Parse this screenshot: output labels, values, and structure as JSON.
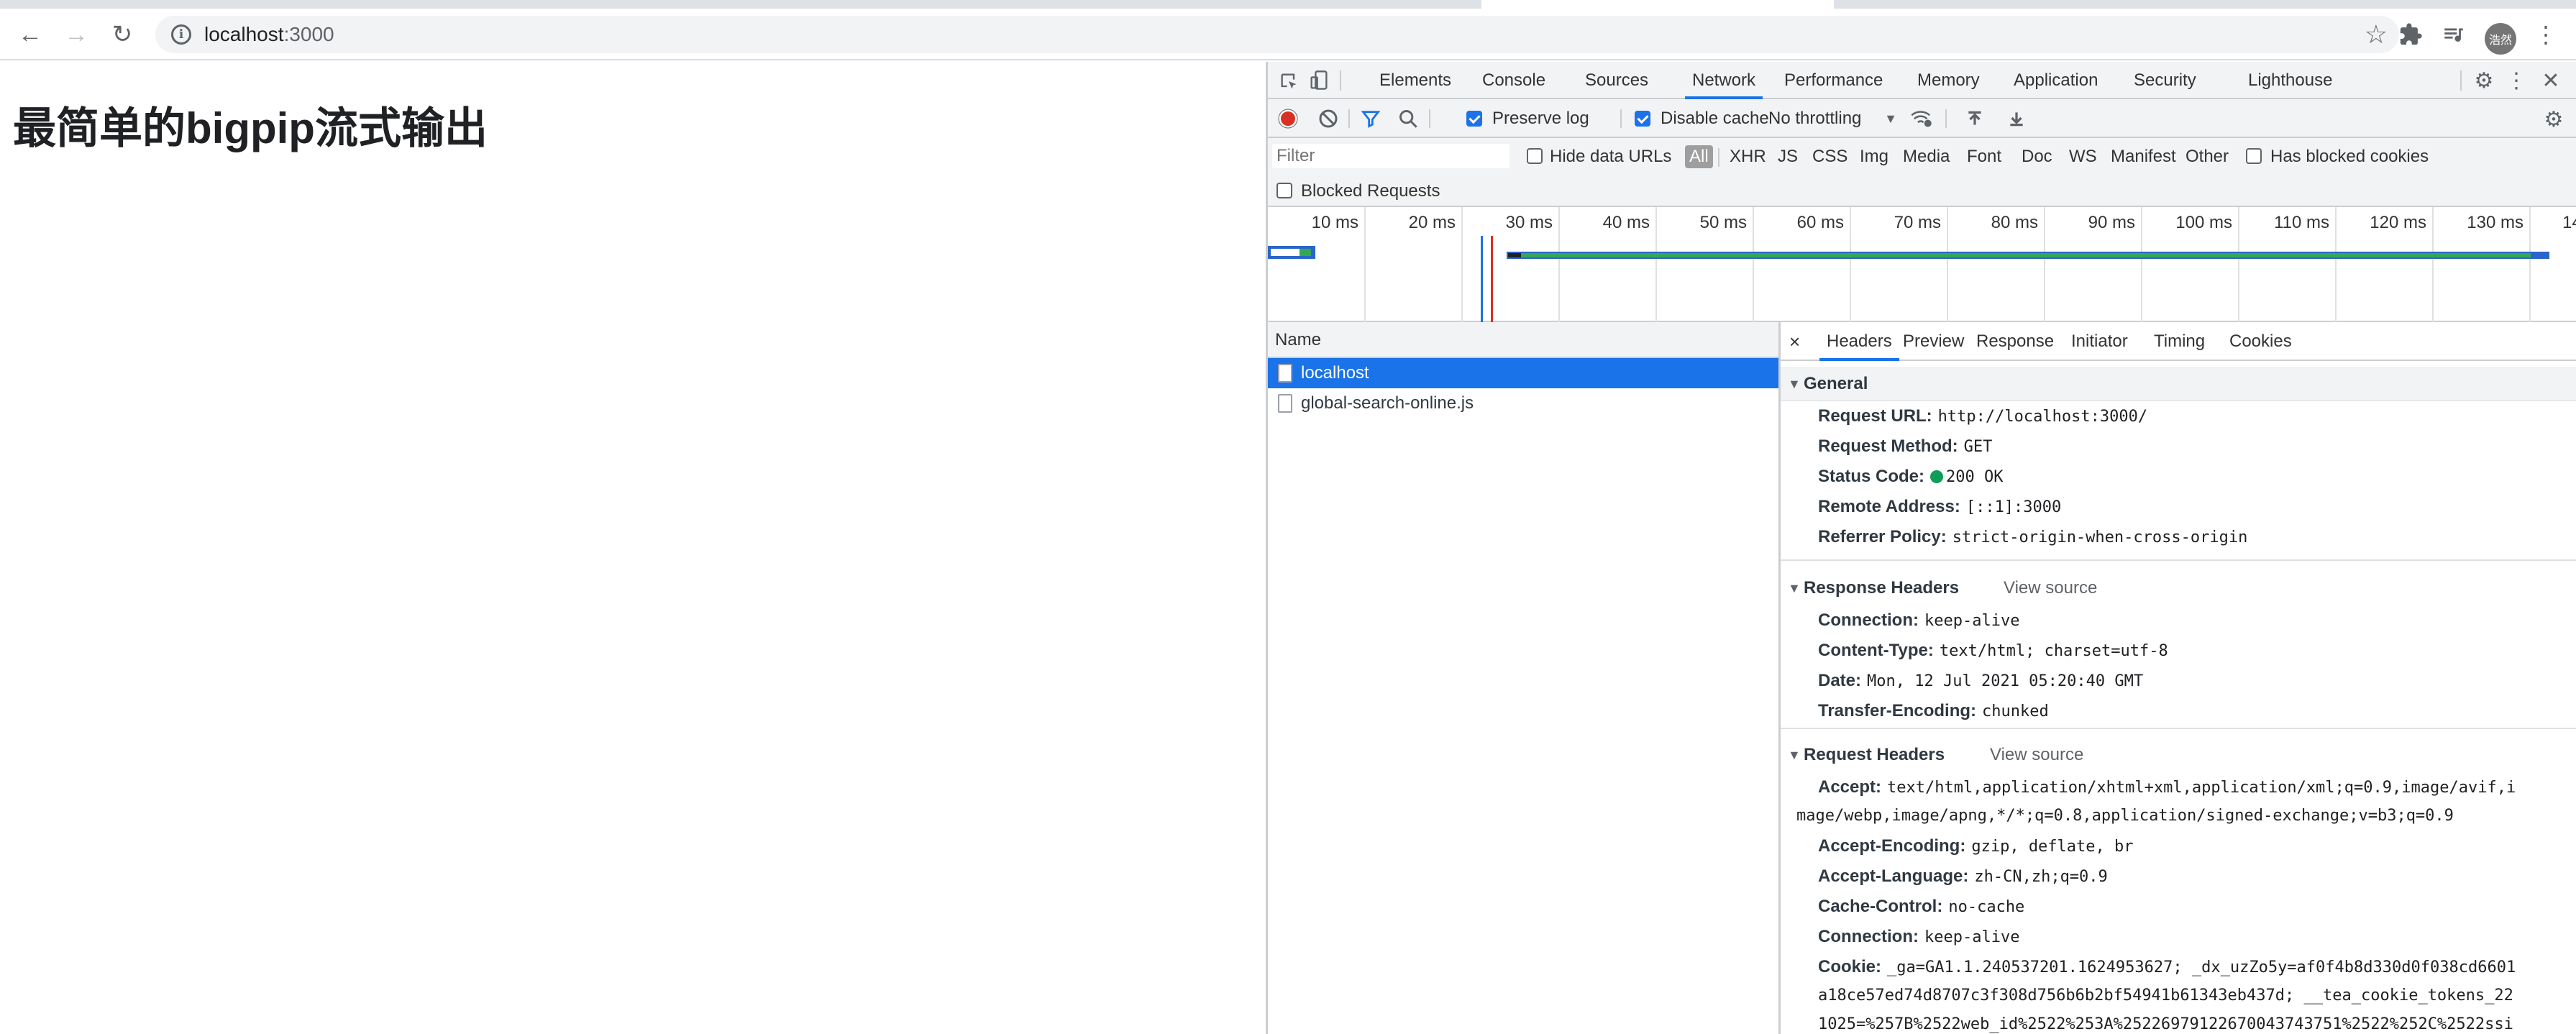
{
  "browser": {
    "address_host": "localhost",
    "address_port": ":3000",
    "avatar_text": "浩然"
  },
  "page": {
    "heading": "最简单的bigpip流式输出"
  },
  "devtools": {
    "tabs": [
      "Elements",
      "Console",
      "Sources",
      "Network",
      "Performance",
      "Memory",
      "Application",
      "Security",
      "Lighthouse"
    ],
    "active_tab": "Network",
    "toolbar": {
      "preserve_log": "Preserve log",
      "disable_cache": "Disable cache",
      "throttling": "No throttling"
    },
    "filter": {
      "placeholder": "Filter",
      "hide_data_urls": "Hide data URLs",
      "types": [
        "All",
        "XHR",
        "JS",
        "CSS",
        "Img",
        "Media",
        "Font",
        "Doc",
        "WS",
        "Manifest",
        "Other"
      ],
      "has_blocked_cookies": "Has blocked cookies",
      "blocked_requests": "Blocked Requests"
    },
    "timeline_ticks": [
      "10 ms",
      "20 ms",
      "30 ms",
      "40 ms",
      "50 ms",
      "60 ms",
      "70 ms",
      "80 ms",
      "90 ms",
      "100 ms",
      "110 ms",
      "120 ms",
      "130 ms",
      "14"
    ],
    "name_column": "Name",
    "requests": [
      "localhost",
      "global-search-online.js"
    ],
    "detail_tabs": [
      "Headers",
      "Preview",
      "Response",
      "Initiator",
      "Timing",
      "Cookies"
    ],
    "general": {
      "title": "General",
      "request_url_k": "Request URL:",
      "request_url_v": "http://localhost:3000/",
      "request_method_k": "Request Method:",
      "request_method_v": "GET",
      "status_code_k": "Status Code:",
      "status_code_v": "200 OK",
      "remote_address_k": "Remote Address:",
      "remote_address_v": "[::1]:3000",
      "referrer_policy_k": "Referrer Policy:",
      "referrer_policy_v": "strict-origin-when-cross-origin"
    },
    "response_headers": {
      "title": "Response Headers",
      "view_source": "View source",
      "connection_k": "Connection:",
      "connection_v": "keep-alive",
      "content_type_k": "Content-Type:",
      "content_type_v": "text/html; charset=utf-8",
      "date_k": "Date:",
      "date_v": "Mon, 12 Jul 2021 05:20:40 GMT",
      "transfer_encoding_k": "Transfer-Encoding:",
      "transfer_encoding_v": "chunked"
    },
    "request_headers": {
      "title": "Request Headers",
      "view_source": "View source",
      "accept_k": "Accept:",
      "accept_v": "text/html,application/xhtml+xml,application/xml;q=0.9,image/avif,i",
      "accept_v2": "mage/webp,image/apng,*/*;q=0.8,application/signed-exchange;v=b3;q=0.9",
      "accept_encoding_k": "Accept-Encoding:",
      "accept_encoding_v": "gzip, deflate, br",
      "accept_language_k": "Accept-Language:",
      "accept_language_v": "zh-CN,zh;q=0.9",
      "cache_control_k": "Cache-Control:",
      "cache_control_v": "no-cache",
      "connection_k": "Connection:",
      "connection_v": "keep-alive",
      "cookie_k": "Cookie:",
      "cookie_v": "_ga=GA1.1.240537201.1624953627; _dx_uzZo5y=af0f4b8d330d0f038cd6601",
      "cookie_v2": "a18ce57ed74d8707c3f308d756b6b2bf54941b61343eb437d; __tea_cookie_tokens_22",
      "cookie_v3": "1025=%257B%2522web_id%2522%253A%25226979122670043743751%2522%252C%2522ssi"
    }
  }
}
